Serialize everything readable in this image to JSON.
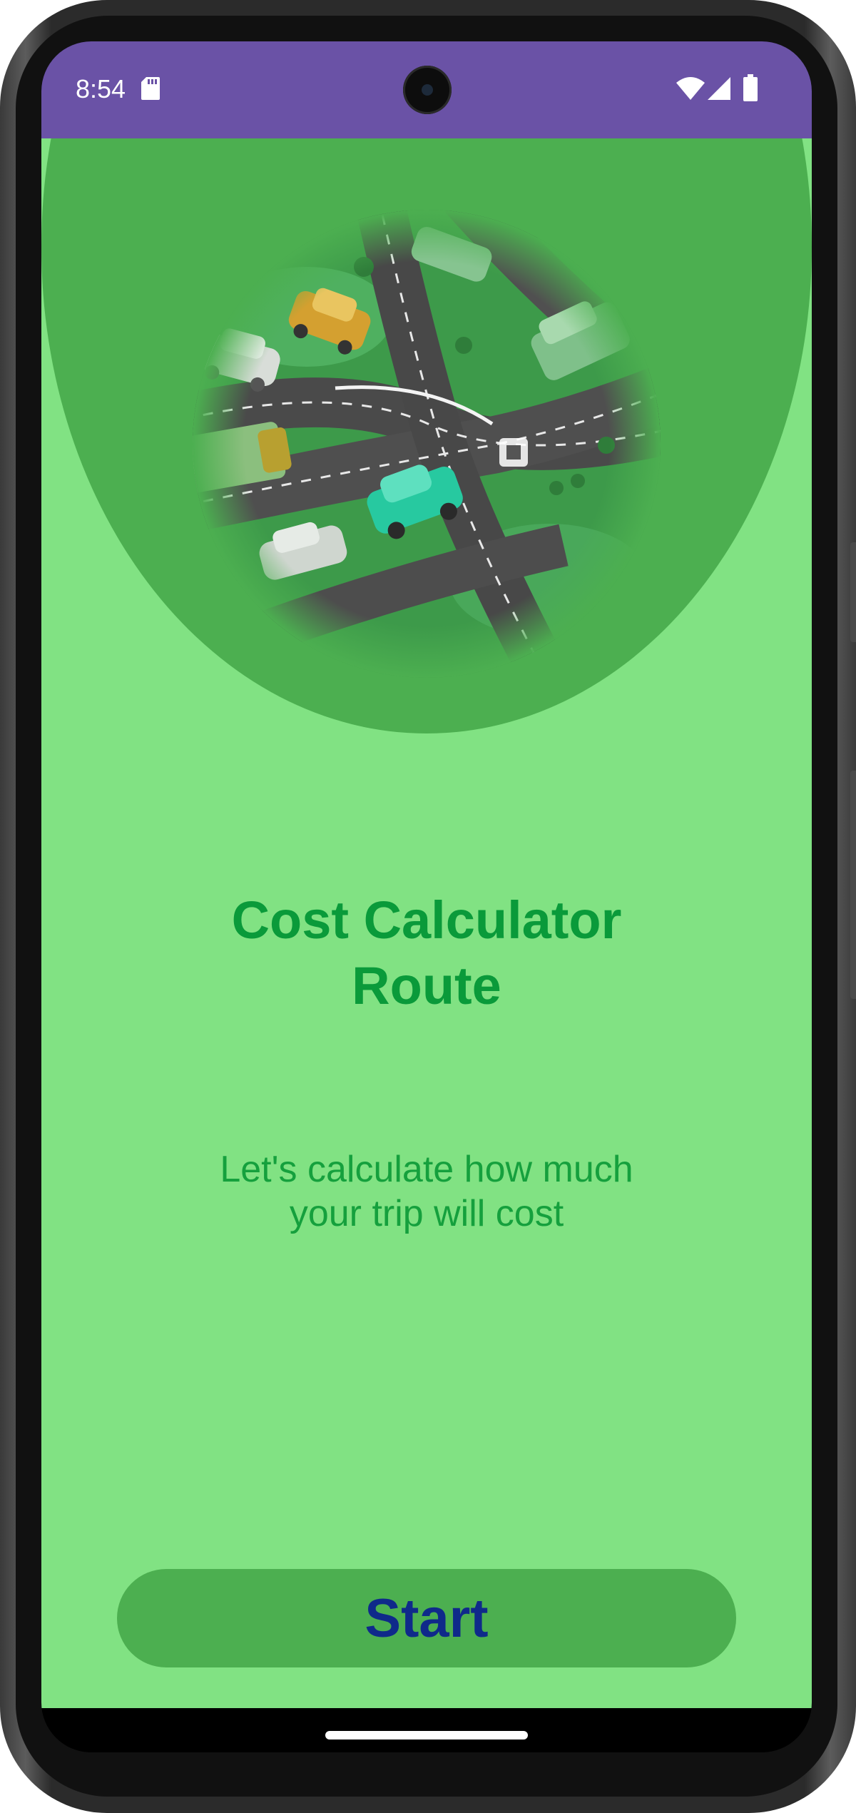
{
  "status_bar": {
    "time": "8:54",
    "icons": [
      "sd-card-icon",
      "wifi-icon",
      "signal-icon",
      "battery-icon"
    ],
    "background": "#6a52a6"
  },
  "app": {
    "background": "#81e283",
    "accent": "#4caf50",
    "title_lines": [
      "Cost Calculator",
      "Route"
    ],
    "subtitle_lines": [
      "Let's calculate how much",
      "your trip will cost"
    ],
    "start_label": "Start",
    "title_color": "#0a9a3a",
    "button_text_color": "#0f2a8a"
  },
  "hero": {
    "image_name": "traffic-intersection-illustration"
  }
}
